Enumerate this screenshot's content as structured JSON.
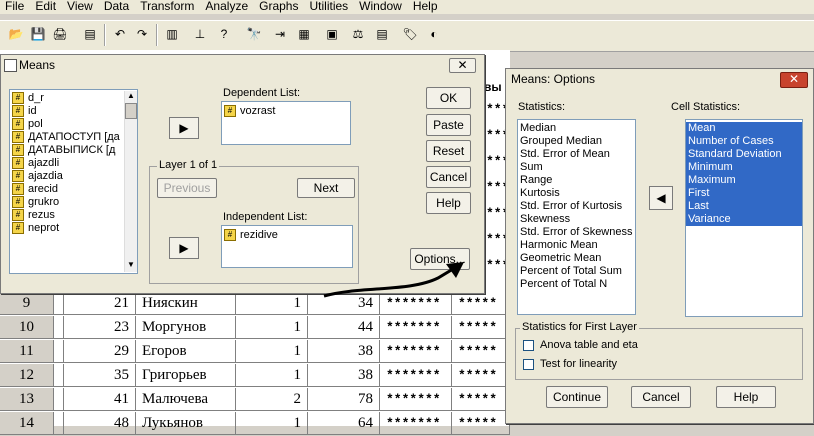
{
  "menu": [
    "File",
    "Edit",
    "View",
    "Data",
    "Transform",
    "Analyze",
    "Graphs",
    "Utilities",
    "Window",
    "Help"
  ],
  "grid": {
    "partial_header": "вы",
    "rows": [
      {
        "n": "9",
        "id": "21",
        "name": "Нияскин",
        "g": "1",
        "age": "34",
        "c5": "*******",
        "c6": "*****"
      },
      {
        "n": "10",
        "id": "23",
        "name": "Моргунов",
        "g": "1",
        "age": "44",
        "c5": "*******",
        "c6": "*****"
      },
      {
        "n": "11",
        "id": "29",
        "name": "Егоров",
        "g": "1",
        "age": "38",
        "c5": "*******",
        "c6": "*****"
      },
      {
        "n": "12",
        "id": "35",
        "name": "Григорьев",
        "g": "1",
        "age": "38",
        "c5": "*******",
        "c6": "*****"
      },
      {
        "n": "13",
        "id": "41",
        "name": "Малючева",
        "g": "2",
        "age": "78",
        "c5": "*******",
        "c6": "*****"
      },
      {
        "n": "14",
        "id": "48",
        "name": "Лукьянов",
        "g": "1",
        "age": "64",
        "c5": "*******",
        "c6": "*****"
      }
    ],
    "hidden_stars": [
      "****",
      "****",
      "****",
      "****",
      "****",
      "****",
      "****"
    ]
  },
  "means": {
    "title": "Means",
    "variables": [
      "d_r",
      "id",
      "pol",
      "ДАТАПОСТУП [да",
      "ДАТАВЫПИСК [д",
      "ajazdli",
      "ajazdia",
      "arecid",
      "grukro",
      "rezus",
      "neprot"
    ],
    "dependent_label": "Dependent List:",
    "dependent_items": [
      "vozrast"
    ],
    "layer_label": "Layer 1 of 1",
    "previous": "Previous",
    "next": "Next",
    "independent_label": "Independent List:",
    "independent_items": [
      "rezidive"
    ],
    "ok": "OK",
    "paste": "Paste",
    "reset": "Reset",
    "cancel": "Cancel",
    "help": "Help",
    "options": "Options..."
  },
  "options": {
    "title": "Means: Options",
    "statistics_label": "Statistics:",
    "statistics": [
      "Median",
      "Grouped Median",
      "Std. Error of Mean",
      "Sum",
      "Range",
      "Kurtosis",
      "Std. Error of Kurtosis",
      "Skewness",
      "Std. Error of Skewness",
      "Harmonic Mean",
      "Geometric Mean",
      "Percent of Total Sum",
      "Percent of Total N"
    ],
    "cell_label": "Cell Statistics:",
    "cell_statistics": [
      "Mean",
      "Number of Cases",
      "Standard Deviation",
      "Minimum",
      "Maximum",
      "First",
      "Last",
      "Variance"
    ],
    "first_layer_label": "Statistics for First Layer",
    "anova": "Anova table and eta",
    "linearity": "Test for linearity",
    "continue": "Continue",
    "cancel": "Cancel",
    "help": "Help"
  }
}
